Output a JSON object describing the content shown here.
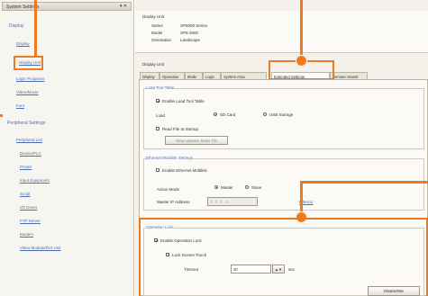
{
  "left_panel": {
    "title": "System Settings",
    "close_glyph": "▾ ✕",
    "display_header": "Display",
    "display_items": [
      "Display",
      "Display Unit",
      "Logic Programs",
      "Video/Movie",
      "Font"
    ],
    "peripheral_header": "Peripheral Settings",
    "peripheral_items": [
      "Peripheral List",
      "Device/PLC",
      "Printer",
      "Input Equipment",
      "Script",
      "I/O Driver",
      "FTP Server",
      "Modem",
      "Video Module/DVI Unit"
    ]
  },
  "info": {
    "section_title": "Display Unit",
    "rows": [
      {
        "label": "Series",
        "value": "SP5000 Series"
      },
      {
        "label": "Model",
        "value": "SP5-3000"
      },
      {
        "label": "Orientation",
        "value": "Landscape"
      }
    ]
  },
  "display_unit_label": "Display Unit",
  "tabs": [
    "Display",
    "Operation",
    "Mode",
    "Logic",
    "System Area",
    "Extended Settings",
    "Remote Viewer"
  ],
  "active_tab": "Extended Settings",
  "load_tool": {
    "title": "Load Tool Table",
    "enable_label": "Enable Load Tool Table",
    "load_label": "Load",
    "sd_label": "SD Card",
    "usb_label": "USB Storage",
    "read_file_label": "Read File at Startup",
    "allow_button": "Allow Updates Setter File"
  },
  "ethernet": {
    "title": "Ethernet Multilink Settings",
    "enable_label": "Enable Ethernet Multilink",
    "mode_label": "Action Mode",
    "master_label": "Master",
    "slave_label": "Slave",
    "ip_label": "Master IP Address",
    "ip_value": "0 . 0 . 0 . 0",
    "filter_label": "Filter(s)"
  },
  "operation_lock": {
    "title": "Operation Lock",
    "enable_label": "Enable Operation Lock",
    "lock_touch_label": "Lock Screen Touch",
    "timeout_label": "Timeout",
    "timeout_value": "30",
    "unit": "sec"
  },
  "disable_button": "Disable/Mte",
  "colors": {
    "accent": "#ee7a1f",
    "link": "#4f6fb0"
  }
}
